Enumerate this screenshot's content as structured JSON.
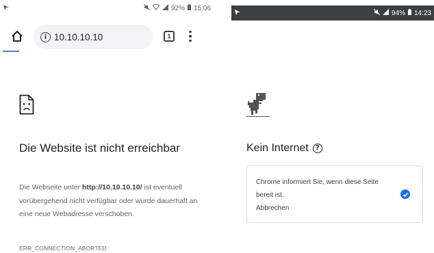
{
  "left_phone": {
    "status_bar": {
      "time": "15:06",
      "battery": "92%",
      "left_icon": "notification-arrow-icon",
      "indicators": "mute-icon wifi-icon signal-icon"
    },
    "toolbar": {
      "url": "10.10.10.10",
      "tab_count": "1"
    },
    "error": {
      "icon": "sad-page-icon",
      "title": "Die Website ist nicht erreichbar",
      "desc_before": "Die Webseite unter ",
      "desc_url": "http://10.10.10.10/",
      "desc_after": " ist eventuell vorübergehend nicht verfügbar oder wurde dauerhaft an eine neue Webadresse verschoben.",
      "code": "ERR_CONNECTION_ABORTED"
    }
  },
  "right_phone": {
    "status_bar": {
      "time": "14:23",
      "battery": "94%",
      "left_icon": "notification-arrow-icon",
      "indicators": "mute-icon signal-icon"
    },
    "offline": {
      "icon": "dino-icon",
      "title": "Kein Internet",
      "notify_text": "Chrome informiert Sie, wenn diese Seite bereit ist.",
      "cancel": "Abbrechen",
      "check_color": "#1a73e8"
    }
  }
}
